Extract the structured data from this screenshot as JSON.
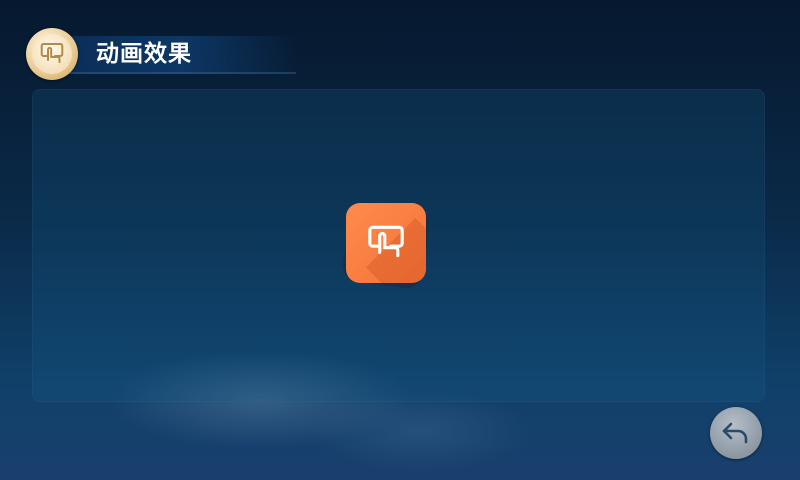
{
  "header": {
    "title": "动画效果",
    "icon": "touch-screen-icon"
  },
  "main": {
    "app_icon": "touch-screen-icon",
    "app_icon_color": "#f47a3e"
  },
  "footer": {
    "back_icon": "back-arrow-icon"
  },
  "colors": {
    "badge_gold": "#d9b06a",
    "title_bar": "#0d3764",
    "back_button": "#9aa4ae"
  }
}
